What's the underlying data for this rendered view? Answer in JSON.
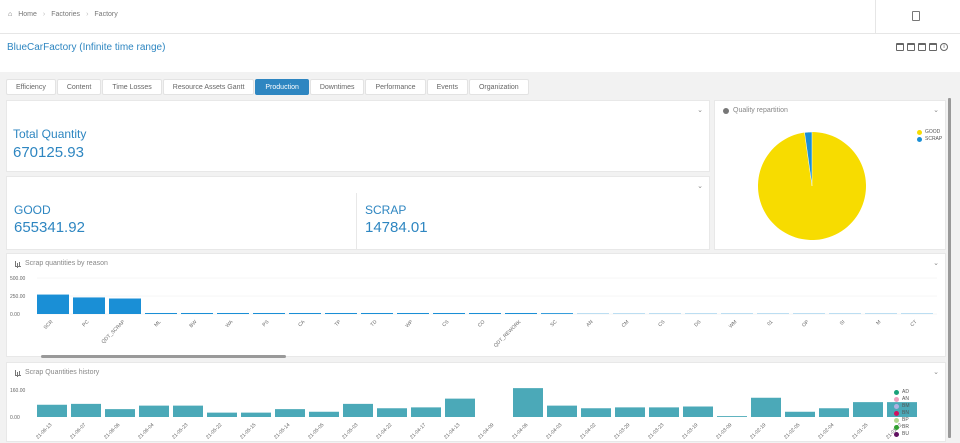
{
  "breadcrumb": {
    "items": [
      "Home",
      "Factories",
      "Factory"
    ]
  },
  "page_title": "BlueCarFactory (Infinite time range)",
  "tabs": [
    {
      "label": "Efficiency"
    },
    {
      "label": "Content"
    },
    {
      "label": "Time Losses"
    },
    {
      "label": "Resource Assets Gantt"
    },
    {
      "label": "Production",
      "active": true
    },
    {
      "label": "Downtimes"
    },
    {
      "label": "Performance"
    },
    {
      "label": "Events"
    },
    {
      "label": "Organization"
    }
  ],
  "total": {
    "label": "Total Quantity",
    "value": "670125.93"
  },
  "good": {
    "label": "GOOD",
    "value": "655341.92"
  },
  "scrap": {
    "label": "SCRAP",
    "value": "14784.01"
  },
  "quality": {
    "title": "Quality repartition",
    "legend": [
      {
        "name": "GOOD",
        "color": "#f7dc00"
      },
      {
        "name": "SCRAP",
        "color": "#1a8fd6"
      }
    ],
    "good_fraction": 0.978
  },
  "scrap_reason": {
    "title": "Scrap quantities by reason",
    "chart_data": {
      "type": "bar",
      "yticks": [
        "500.00",
        "250.00",
        "0.00"
      ],
      "ylim": [
        0,
        500
      ],
      "categories": [
        "SCR",
        "PC",
        "QDT_SCRAP",
        "ML",
        "BW",
        "WA",
        "PS",
        "CA",
        "TP",
        "TD",
        "WP",
        "CS",
        "CO",
        "QDT_REWORK",
        "SC",
        "AN",
        "CM",
        "CS",
        "DS",
        "WM",
        "01",
        "OP",
        "SI",
        "M",
        "CT"
      ],
      "values": [
        270,
        230,
        215,
        14,
        14,
        14,
        14,
        14,
        14,
        14,
        14,
        14,
        14,
        14,
        12,
        4,
        4,
        4,
        4,
        4,
        4,
        4,
        4,
        4,
        4
      ],
      "color": "#1a8fd6"
    }
  },
  "scrap_history": {
    "title": "Scrap Quantities history",
    "chart_data": {
      "type": "bar",
      "yticks": [
        "160.00",
        "0.00"
      ],
      "ylim": [
        0,
        160
      ],
      "categories": [
        "21-06-13",
        "21-06-07",
        "21-06-06",
        "21-06-04",
        "21-05-23",
        "21-05-22",
        "21-05-15",
        "21-05-14",
        "21-05-05",
        "21-05-03",
        "21-04-22",
        "21-04-17",
        "21-04-13",
        "21-04-09",
        "21-04-06",
        "21-04-03",
        "21-04-02",
        "21-03-29",
        "21-03-23",
        "21-03-19",
        "21-03-09",
        "21-02-19",
        "21-02-05",
        "21-02-04",
        "21-01-25",
        "21-01-22"
      ],
      "values": [
        70,
        75,
        45,
        65,
        65,
        25,
        25,
        45,
        30,
        75,
        50,
        55,
        105,
        0,
        165,
        65,
        50,
        55,
        55,
        60,
        5,
        110,
        30,
        50,
        85,
        85
      ],
      "color": "#4ba9b8",
      "legend": [
        {
          "name": "AD",
          "color": "#1aa17a"
        },
        {
          "name": "AN",
          "color": "#f0a0c0"
        },
        {
          "name": "BM",
          "color": "#b0b0e0"
        },
        {
          "name": "BN",
          "color": "#d01060"
        },
        {
          "name": "BP",
          "color": "#b0d890"
        },
        {
          "name": "BR",
          "color": "#30a030"
        },
        {
          "name": "BU",
          "color": "#601060"
        }
      ]
    }
  }
}
